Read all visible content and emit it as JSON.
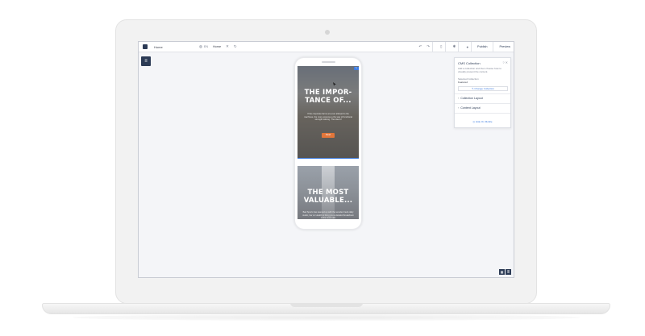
{
  "toolbar": {
    "page_tab": "Home",
    "language_code": "EN",
    "page_select": "Home",
    "publish_label": "Publish",
    "preview_label": "Preview"
  },
  "canvas": {
    "card1": {
      "title": "THE IMPOR-TANCE OF...",
      "text": "If the corporate farms are ever allowed to the machines, the more expense a the way of functional strength training. The idea of",
      "button_label": "Read"
    },
    "card2": {
      "title": "THE MOST VALUABLE...",
      "text": "Bad Sports has teamed up with the wooden hand-daily studio, bar on Health to bring you a detailed breakdown of the most valu"
    }
  },
  "panel": {
    "title": "CMS Collection",
    "description": "Add a collection and then choose how to visually present the content.",
    "selected_label": "Selected Collection",
    "selected_value": "Featured",
    "change_button": "Change Collection",
    "section_layout": "Collection Layout",
    "section_content": "Content Layout",
    "hide_mobile": "Hide On Mobile"
  },
  "colors": {
    "accent": "#2b3a55",
    "highlight": "#3f7de0",
    "button": "#e2763a"
  }
}
